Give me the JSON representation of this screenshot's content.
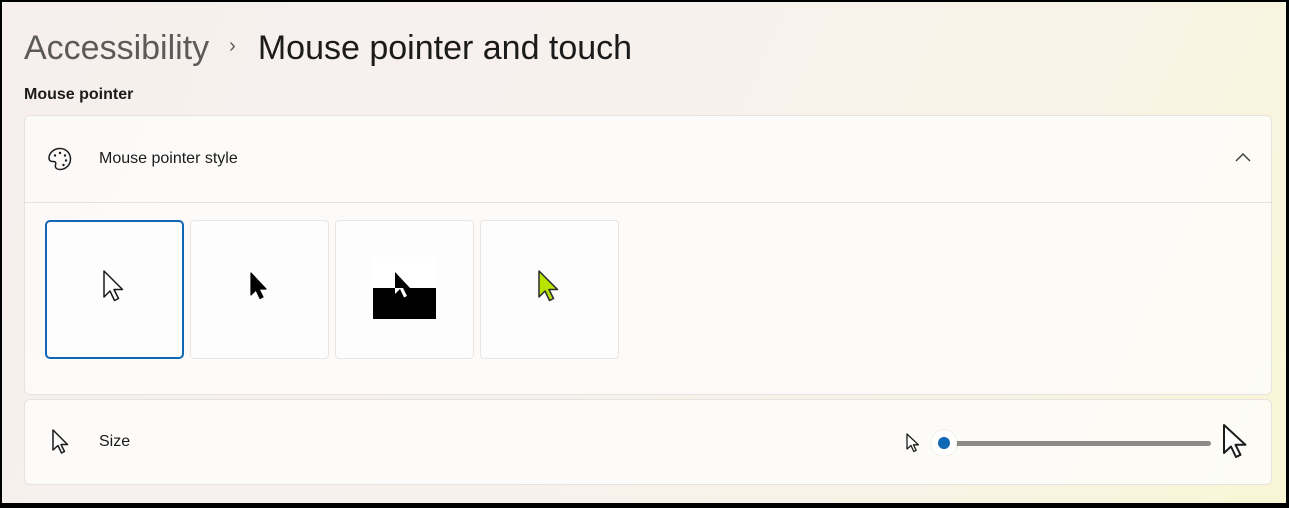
{
  "breadcrumb": {
    "parent": "Accessibility",
    "separator": "›",
    "current": "Mouse pointer and touch"
  },
  "section": {
    "label": "Mouse pointer"
  },
  "pointer_style": {
    "label": "Mouse pointer style",
    "icon": "palette-icon",
    "expanded": true,
    "options": [
      {
        "name": "white",
        "icon": "white-pointer-icon",
        "selected": true
      },
      {
        "name": "black",
        "icon": "black-pointer-icon",
        "selected": false
      },
      {
        "name": "inverted",
        "icon": "inverted-pointer-icon",
        "selected": false
      },
      {
        "name": "custom",
        "icon": "custom-color-pointer-icon",
        "selected": false,
        "color": "#b8e500"
      }
    ]
  },
  "size": {
    "label": "Size",
    "icon": "pointer-icon",
    "slider_value": 1,
    "slider_min": 1,
    "slider_max": 15
  },
  "colors": {
    "accent": "#0f67b5"
  }
}
